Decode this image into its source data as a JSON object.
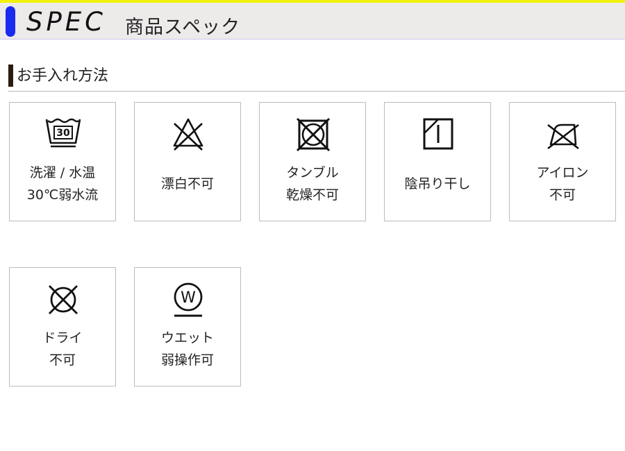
{
  "header": {
    "title": "SPEC",
    "subtitle": "商品スペック"
  },
  "section": {
    "title": "お手入れ方法"
  },
  "care_items": [
    {
      "symbol": "wash-tub-30-icon",
      "label_lines": [
        "洗濯 / 水温",
        "30℃弱水流"
      ]
    },
    {
      "symbol": "no-bleach-icon",
      "label_lines": [
        "漂白不可"
      ]
    },
    {
      "symbol": "no-tumble-dry-icon",
      "label_lines": [
        "タンブル",
        "乾燥不可"
      ]
    },
    {
      "symbol": "shade-line-dry-icon",
      "label_lines": [
        "陰吊り干し"
      ]
    },
    {
      "symbol": "no-iron-icon",
      "label_lines": [
        "アイロン",
        "不可"
      ]
    },
    {
      "symbol": "no-dry-clean-icon",
      "label_lines": [
        "ドライ",
        "不可"
      ]
    },
    {
      "symbol": "wet-clean-gentle-icon",
      "label_lines": [
        "ウエット",
        "弱操作可"
      ]
    }
  ],
  "wash_temperature_mark": "30",
  "wet_clean_mark": "W",
  "colors": {
    "header_top_border": "#f1f10a",
    "header_background": "#edeaea",
    "header_marker": "#1a2af0",
    "section_bar": "#2a1c10",
    "card_border": "#bcbcbc"
  }
}
